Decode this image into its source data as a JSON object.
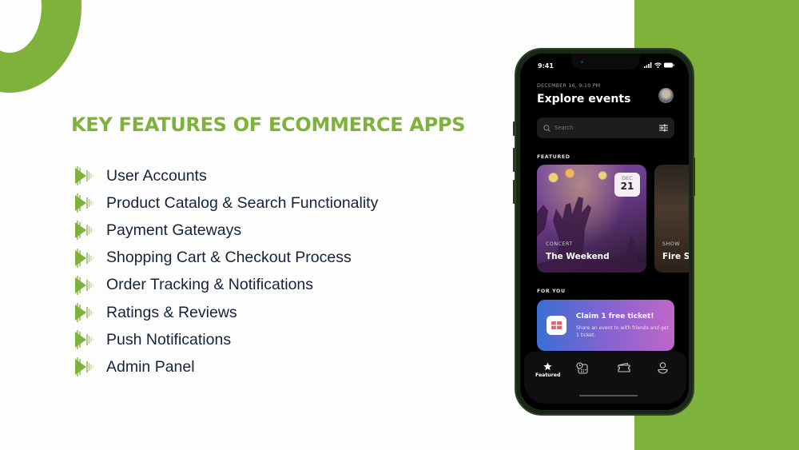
{
  "slide": {
    "title": "KEY FEATURES OF ECOMMERCE APPS",
    "accent_color": "#7fb23a",
    "text_color": "#14233d",
    "bullet_icon": "play-arrow-icon",
    "features": [
      "User Accounts",
      "Product Catalog & Search Functionality",
      "Payment Gateways",
      "Shopping Cart & Checkout Process",
      "Order Tracking & Notifications",
      "Ratings & Reviews",
      "Push Notifications",
      "Admin Panel"
    ]
  },
  "phone": {
    "status_time": "9:41",
    "date_line": "DECEMBER 16, 9:10 PM",
    "heading": "Explore events",
    "search_placeholder": "Search",
    "featured_label": "FEATURED",
    "featured_cards": [
      {
        "category": "CONCERT",
        "name": "The Weekend",
        "month": "DEC",
        "day": "21"
      },
      {
        "category": "SHOW",
        "name": "Fire S"
      }
    ],
    "for_you_label": "FOR YOU",
    "promo": {
      "title": "Claim 1 free ticket!",
      "subtitle": "Share an event to with friends and get 1 ticket."
    },
    "tabs": [
      {
        "label": "Featured",
        "icon": "star-icon",
        "active": true
      },
      {
        "label": "",
        "icon": "calendar-clock-icon",
        "active": false
      },
      {
        "label": "",
        "icon": "ticket-icon",
        "active": false
      },
      {
        "label": "",
        "icon": "profile-icon",
        "active": false
      }
    ]
  }
}
